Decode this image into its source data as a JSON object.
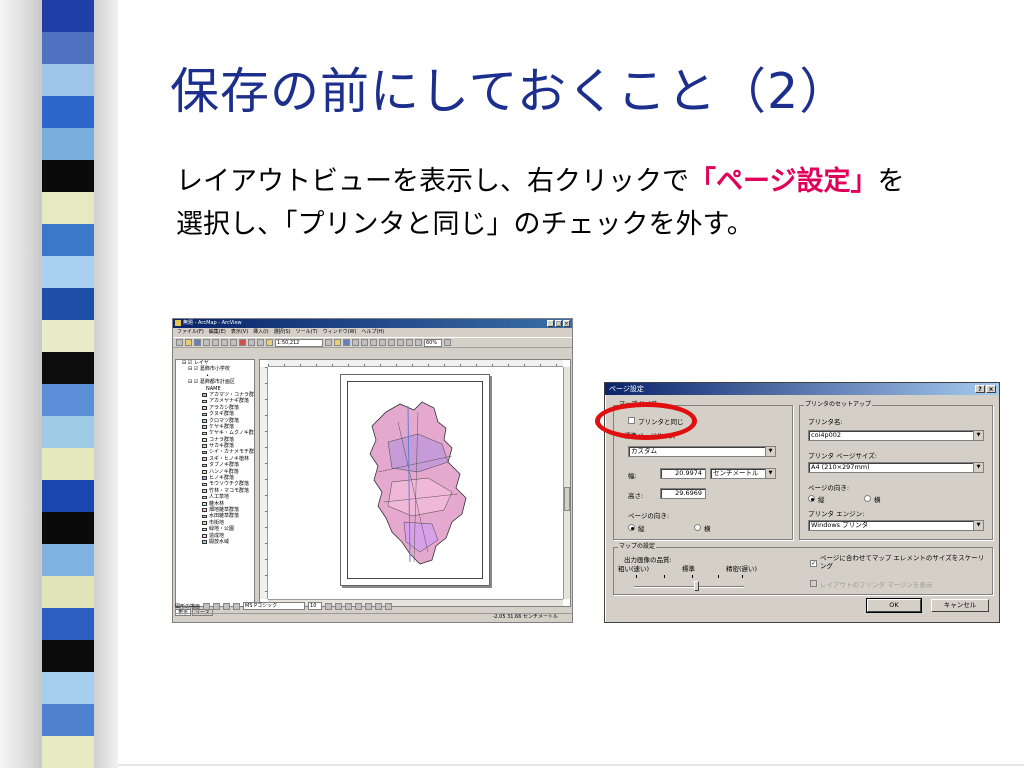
{
  "slide": {
    "title": "保存の前にしておくこと（2）",
    "desc_line1_pre": "レイアウトビューを表示し、右クリックで",
    "desc_line1_em": "「ページ設定」",
    "desc_line1_post": "を",
    "desc_line2": "選択し、「プリンタと同じ」のチェックを外す。"
  },
  "stripe_colors": [
    "#1f3ea6",
    "#5070c0",
    "#9ec4e8",
    "#2d66c8",
    "#7aaedc",
    "#0a0a0a",
    "#e6eac0",
    "#3c78c8",
    "#a9d0f0",
    "#1d4fa8",
    "#e8ecc8",
    "#0c0c0c",
    "#5b8fd8",
    "#9fcbe6",
    "#e4e8bc",
    "#1a46b0",
    "#0a0a0a",
    "#7fb2e0",
    "#dfe5b8",
    "#2b5ec0",
    "#0b0b0b",
    "#a6cfee",
    "#4e82d0",
    "#e6ebc2"
  ],
  "arcmap": {
    "title": "無題 - ArcMap - ArcView",
    "window_buttons": [
      "_",
      "□",
      "×"
    ],
    "menu": [
      "ファイル(F)",
      "編集(E)",
      "表示(V)",
      "挿入(I)",
      "選択(S)",
      "ツール(T)",
      "ウィンドウ(W)",
      "ヘルプ(H)"
    ],
    "scale": "1:50,212",
    "zoom": "60%",
    "toc": {
      "root": "レイヤ",
      "layer1": "葛飾市小学校",
      "layer2": "葛飾都市計画区",
      "field": "NAME",
      "legend": [
        "アカマツ・コナラ群落",
        "アカメヤナギ群落",
        "アラカシ群落",
        "クヌギ群落",
        "クロマツ群落",
        "ケヤキ群落",
        "ケヤキ・ムクノキ群落",
        "コナラ群落",
        "サカキ群落",
        "シイ・カナメモチ群落",
        "スギ・ヒノキ植林",
        "タブノキ群落",
        "ハンノキ群落",
        "ヒノキ群落",
        "モウソウチク群落",
        "竹林・マコモ群落",
        "人工草地",
        "雑木林",
        "畑地雑草群落",
        "水田雑草群落",
        "市街地",
        "緑地・公園",
        "造成地",
        "開放水域"
      ],
      "legend_colors": [
        "#d8a0c8",
        "#c8d8f0",
        "#f0c0a0",
        "#b0d0f0",
        "#a8e0c8",
        "#e0b0e0",
        "#f0d890",
        "#c8f0c0",
        "#e8c8a8",
        "#b8b8e8",
        "#f0b8b8",
        "#a8d8d8",
        "#d8e8a8",
        "#c0a8d8",
        "#f0e0b0",
        "#b8e0f0",
        "#e8d0f0",
        "#c8e8b8",
        "#f8c8d8",
        "#b0c8e0",
        "#e0e0a0",
        "#d0f0e0",
        "#f0c8f0",
        "#a8c8f8"
      ],
      "tabs": [
        "表示",
        "ソース"
      ]
    },
    "draw_label": "図形の描画",
    "font": "MS Pゴシック",
    "font_size": "10",
    "status": "-2.05  31.66 センチメートル"
  },
  "dialog": {
    "title": "ページ設定",
    "help_button": "?",
    "close_button": "×",
    "map_size_group": "マップ サイズ",
    "same_as_printer": "プリンタと同じ",
    "standard_size_label": "標準ページサイズ",
    "page_size_value": "カスタム",
    "width_label": "幅:",
    "width_value": "20.9974",
    "unit_value": "センチメートル",
    "height_label": "高さ:",
    "height_value": "29.6969",
    "orientation_label": "ページの向き:",
    "portrait": "縦",
    "landscape": "横",
    "printer_group": "プリンタのセットアップ",
    "printer_name_label": "プリンタ名:",
    "printer_name_value": "coi4p002",
    "printer_paper_label": "プリンタ ページサイズ:",
    "printer_paper_value": "A4 (210×297mm)",
    "printer_orientation_label": "ページの向き:",
    "printer_engine_label": "プリンタ エンジン:",
    "printer_engine_value": "Windows プリンタ",
    "map_settings_group": "マップの設定",
    "output_quality_label": "出力画像の品質:",
    "quality_low": "粗い(速い)",
    "quality_mid": "標準",
    "quality_high": "精密(遅い)",
    "scale_elements": "ページに合わせてマップ エレメントのサイズをスケーリング",
    "show_printer_margins": "レイアウトのプリンタ マージンを表示",
    "ok": "OK",
    "cancel": "キャンセル"
  }
}
